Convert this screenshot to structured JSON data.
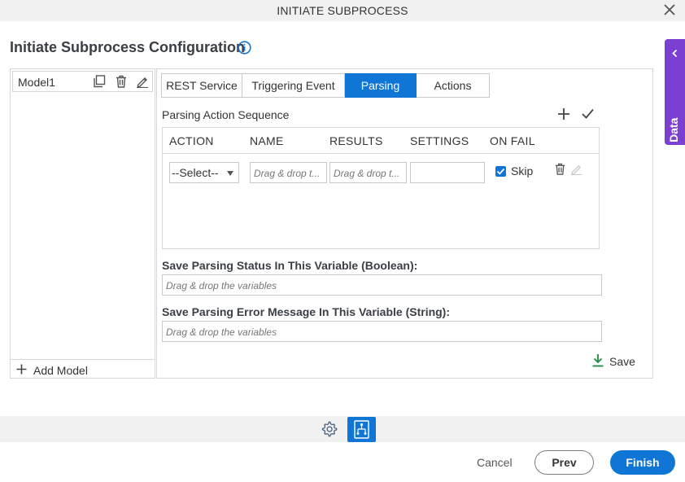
{
  "window": {
    "title": "INITIATE SUBPROCESS",
    "close_icon": "close-icon"
  },
  "page": {
    "title": "Initiate Subprocess Configuration",
    "info_icon": "info-icon"
  },
  "app_data": {
    "label": "App Data",
    "icon": "chevron-left-icon",
    "color": "#7b3fd1"
  },
  "models": {
    "items": [
      {
        "name": "Model1"
      }
    ],
    "row_icons": [
      "copy-icon",
      "delete-icon",
      "edit-icon"
    ],
    "add_label": "Add Model"
  },
  "tabs": [
    {
      "label": "REST Service",
      "active": false
    },
    {
      "label": "Triggering Event",
      "active": false
    },
    {
      "label": "Parsing",
      "active": true
    },
    {
      "label": "Actions",
      "active": false
    }
  ],
  "parsing": {
    "section_title": "Parsing Action Sequence",
    "columns": [
      "ACTION",
      "NAME",
      "RESULTS",
      "SETTINGS",
      "ON FAIL"
    ],
    "row": {
      "action": "--Select--",
      "name_placeholder": "Drag & drop t...",
      "results_placeholder": "Drag & drop t...",
      "settings": "",
      "on_fail_checked": true,
      "on_fail_label": "Skip"
    },
    "status_label": "Save Parsing Status In This Variable (Boolean):",
    "status_placeholder": "Drag & drop the variables",
    "error_label": "Save Parsing Error Message In This Variable (String):",
    "error_placeholder": "Drag & drop the variables",
    "save_label": "Save"
  },
  "footer": {
    "cancel_label": "Cancel",
    "prev_label": "Prev",
    "finish_label": "Finish",
    "accent": "#0f76d6"
  }
}
